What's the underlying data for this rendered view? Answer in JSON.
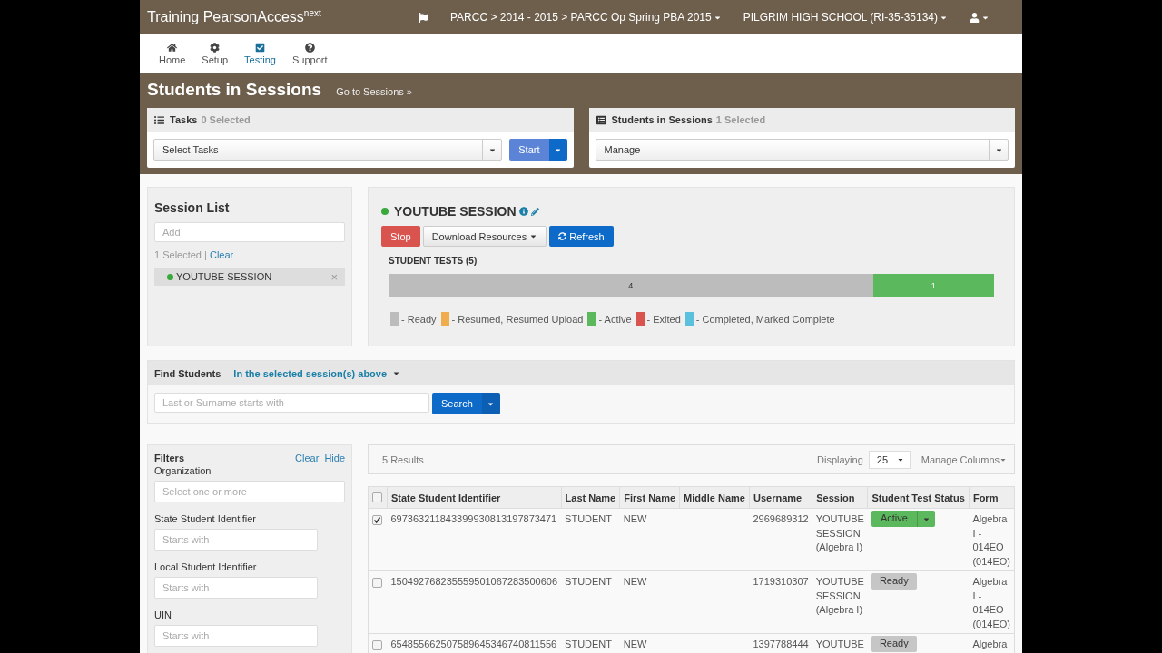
{
  "header": {
    "brand": "Training PearsonAccess",
    "brand_sup": "next",
    "breadcrumb": "PARCC > 2014 - 2015 > PARCC Op Spring PBA 2015",
    "organization": "PILGRIM HIGH SCHOOL (RI-35-35134)"
  },
  "nav": [
    {
      "label": "Home",
      "selected": false
    },
    {
      "label": "Setup",
      "selected": false
    },
    {
      "label": "Testing",
      "selected": true
    },
    {
      "label": "Support",
      "selected": false
    }
  ],
  "page": {
    "title": "Students in Sessions",
    "link": "Go to Sessions »"
  },
  "tasks_panel": {
    "title": "Tasks",
    "count": "0 Selected",
    "select": "Select Tasks",
    "button": "Start"
  },
  "students_panel": {
    "title": "Students in Sessions",
    "count": "1 Selected",
    "select": "Manage"
  },
  "session_list": {
    "title": "Session List",
    "placeholder": "Add",
    "selected_count": "1 Selected",
    "separator": "|",
    "clear": "Clear",
    "items": [
      {
        "name": "YOUTUBE SESSION",
        "color": "#3aa83a",
        "remove": "×"
      }
    ]
  },
  "session": {
    "name": "YOUTUBE SESSION",
    "color": "#3aa83a",
    "buttons": [
      {
        "label": "Stop",
        "kind": "danger"
      },
      {
        "label": "Download Resources",
        "kind": "dropdown"
      },
      {
        "label": "Refresh",
        "kind": "primary"
      }
    ],
    "tests_title": "STUDENT TESTS (5)",
    "bar": [
      {
        "count": "4",
        "level": 0.8,
        "color": "#bcbcbc"
      },
      {
        "count": "1",
        "level": 0.2,
        "color": "#5cb85c"
      }
    ],
    "legend": [
      {
        "label": "- Ready",
        "color": "#bcbcbc"
      },
      {
        "label": "- Resumed, Resumed Upload",
        "color": "#f0ad4e"
      },
      {
        "label": "- Active",
        "color": "#5cb85c"
      },
      {
        "label": "- Exited",
        "color": "#d9534f"
      },
      {
        "label": "- Completed, Marked Complete",
        "color": "#5bc0de"
      }
    ]
  },
  "find": {
    "title": "Find Students",
    "scope": "In the selected session(s) above",
    "placeholder": "Last or Surname starts with",
    "button": "Search"
  },
  "filters": {
    "title": "Filters",
    "clear": "Clear",
    "hide": "Hide",
    "fields": [
      {
        "label": "Organization",
        "placeholder": "Select one or more",
        "kind": "wide"
      },
      {
        "label": "State Student Identifier",
        "placeholder": "Starts with",
        "kind": "short"
      },
      {
        "label": "Local Student Identifier",
        "placeholder": "Starts with",
        "kind": "short"
      },
      {
        "label": "UIN",
        "placeholder": "Starts with",
        "kind": "short"
      }
    ]
  },
  "results": {
    "count": "5 Results",
    "displaying": "Displaying",
    "page_size": "25",
    "manage": "Manage Columns",
    "all_checked": false,
    "columns": [
      "State Student Identifier",
      "Last Name",
      "First Name",
      "Middle Name",
      "Username",
      "Session",
      "Student Test Status",
      "Form"
    ],
    "rows": [
      {
        "checked": true,
        "id": "697363211843399930813197873471",
        "last": "STUDENT",
        "first": "NEW",
        "username": "2969689312",
        "session": "YOUTUBE SESSION (Algebra I)",
        "status": "Active",
        "kind": "active",
        "form": "Algebra I - 014EO (014EO)"
      },
      {
        "checked": false,
        "id": "150492768235559501067283500606",
        "last": "STUDENT",
        "first": "NEW",
        "username": "1719310307",
        "session": "YOUTUBE SESSION (Algebra I)",
        "status": "Ready",
        "kind": "ready",
        "form": "Algebra I - 014EO (014EO)"
      },
      {
        "checked": false,
        "id": "654855662507589645346740811556",
        "last": "STUDENT",
        "first": "NEW",
        "username": "1397788444",
        "session": "YOUTUBE",
        "status": "Ready",
        "kind": "ready",
        "form": "Algebra"
      }
    ]
  }
}
